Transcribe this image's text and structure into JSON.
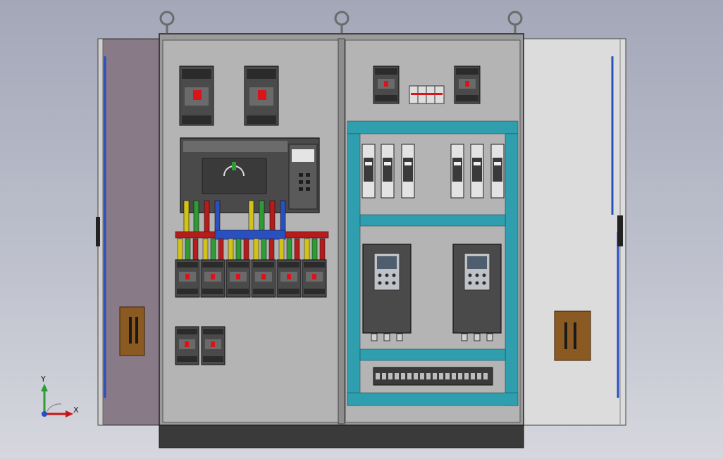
{
  "axes": {
    "x_label": "X",
    "y_label": "Y"
  },
  "colors": {
    "cabinet": "#b4b4b4",
    "door_left": "#897a88",
    "door_right": "#dcdcdc",
    "plinth": "#3a3a3a",
    "phase_l1": "#d1c31b",
    "phase_l2": "#2f9b34",
    "phase_l3": "#b51d1d",
    "neutral": "#2a4fbf",
    "tray": "#2f9fb0",
    "wood": "#8a5a22",
    "breaker_lever": "#d8151a",
    "hmi_screen": "#4f5e6e"
  }
}
